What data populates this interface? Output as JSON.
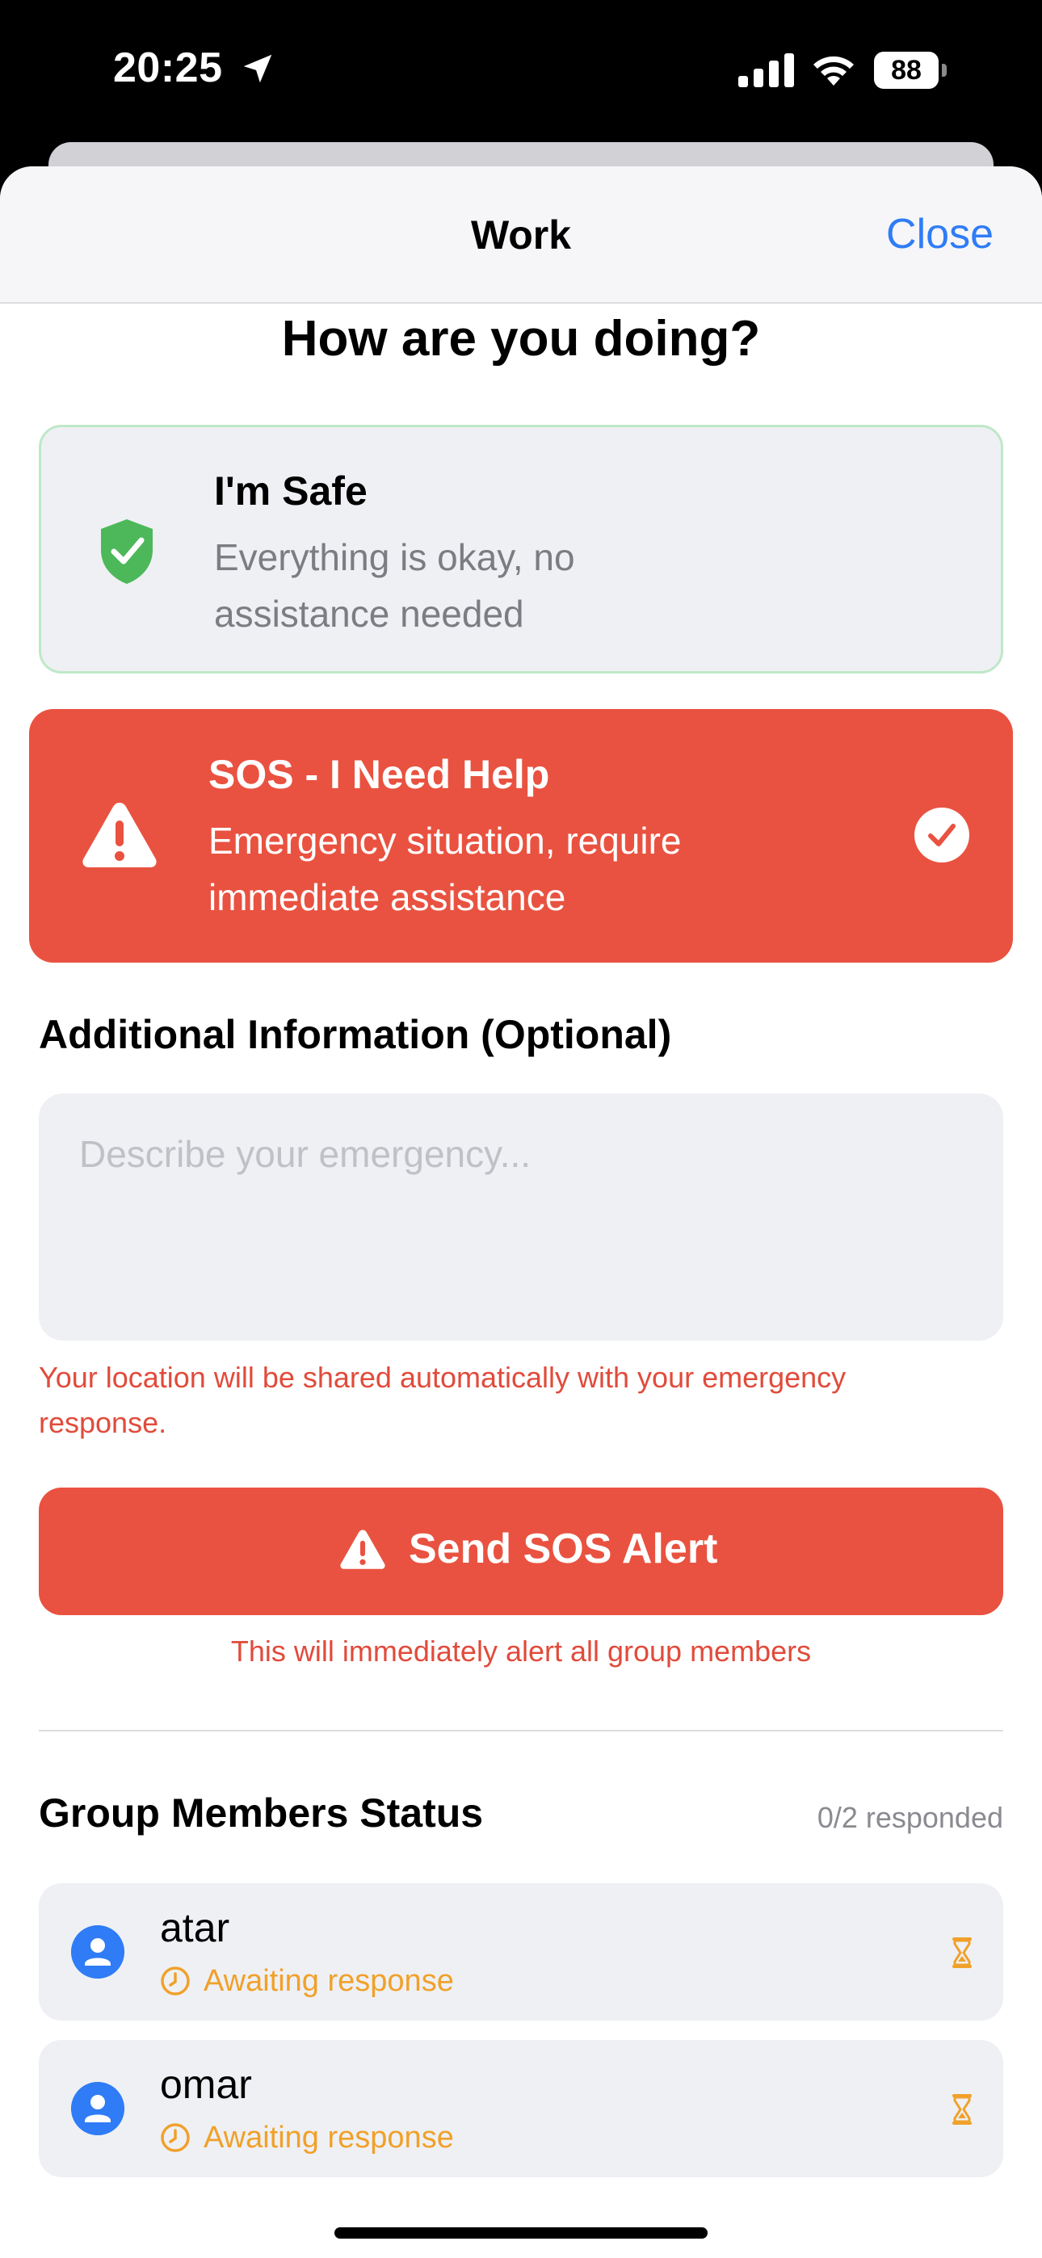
{
  "status_bar": {
    "time": "20:25",
    "battery": "88"
  },
  "nav": {
    "title": "Work",
    "close_label": "Close"
  },
  "question": "How are you doing?",
  "options": {
    "safe": {
      "title": "I'm Safe",
      "description": "Everything is okay, no assistance needed"
    },
    "sos": {
      "title": "SOS - I Need Help",
      "description": "Emergency situation, require immediate assistance",
      "selected": true
    }
  },
  "additional": {
    "label": "Additional Information (Optional)",
    "placeholder": "Describe your emergency...",
    "value": ""
  },
  "location_note": "Your location will be shared automatically with your emergency response.",
  "send_button": {
    "label": "Send SOS Alert"
  },
  "alert_note": "This will immediately alert all group members",
  "members": {
    "title": "Group Members Status",
    "responded": "0/2 responded",
    "list": [
      {
        "name": "atar",
        "status": "Awaiting response"
      },
      {
        "name": "omar",
        "status": "Awaiting response"
      }
    ]
  },
  "colors": {
    "accent_blue": "#2f7cf6",
    "sos_red": "#e95240",
    "safe_green": "#4cb85a",
    "awaiting_orange": "#f0a12a"
  },
  "icons": [
    "location-arrow-icon",
    "cellular-signal-icon",
    "wifi-icon",
    "battery-icon",
    "shield-check-icon",
    "warning-triangle-icon",
    "checkmark-circle-icon",
    "person-icon",
    "clock-icon",
    "hourglass-icon"
  ]
}
